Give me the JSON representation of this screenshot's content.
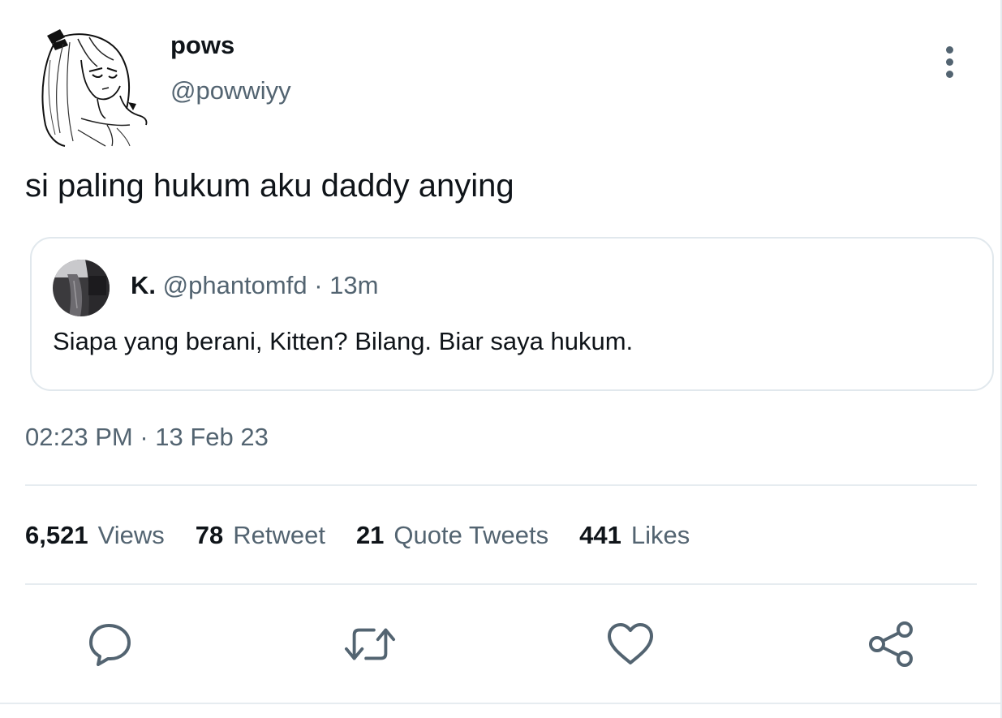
{
  "tweet": {
    "author": {
      "name": "pows",
      "handle": "@powwiyy"
    },
    "text": "si paling hukum aku daddy anying",
    "quoted": {
      "name": "K.",
      "handle": "@phantomfd",
      "separator": "·",
      "age": "13m",
      "text": "Siapa yang berani, Kitten? Bilang. Biar saya hukum."
    },
    "timestamp": {
      "time": "02:23 PM",
      "separator": "·",
      "date": "13 Feb 23"
    },
    "stats": [
      {
        "value": "6,521",
        "label": "Views"
      },
      {
        "value": "78",
        "label": "Retweet"
      },
      {
        "value": "21",
        "label": "Quote Tweets"
      },
      {
        "value": "441",
        "label": "Likes"
      }
    ]
  },
  "actions": [
    {
      "icon": "reply-icon"
    },
    {
      "icon": "retweet-icon"
    },
    {
      "icon": "like-icon"
    },
    {
      "icon": "share-icon"
    }
  ],
  "colors": {
    "text_primary": "#0f1419",
    "text_secondary": "#536471",
    "border": "#e1e8ed"
  }
}
